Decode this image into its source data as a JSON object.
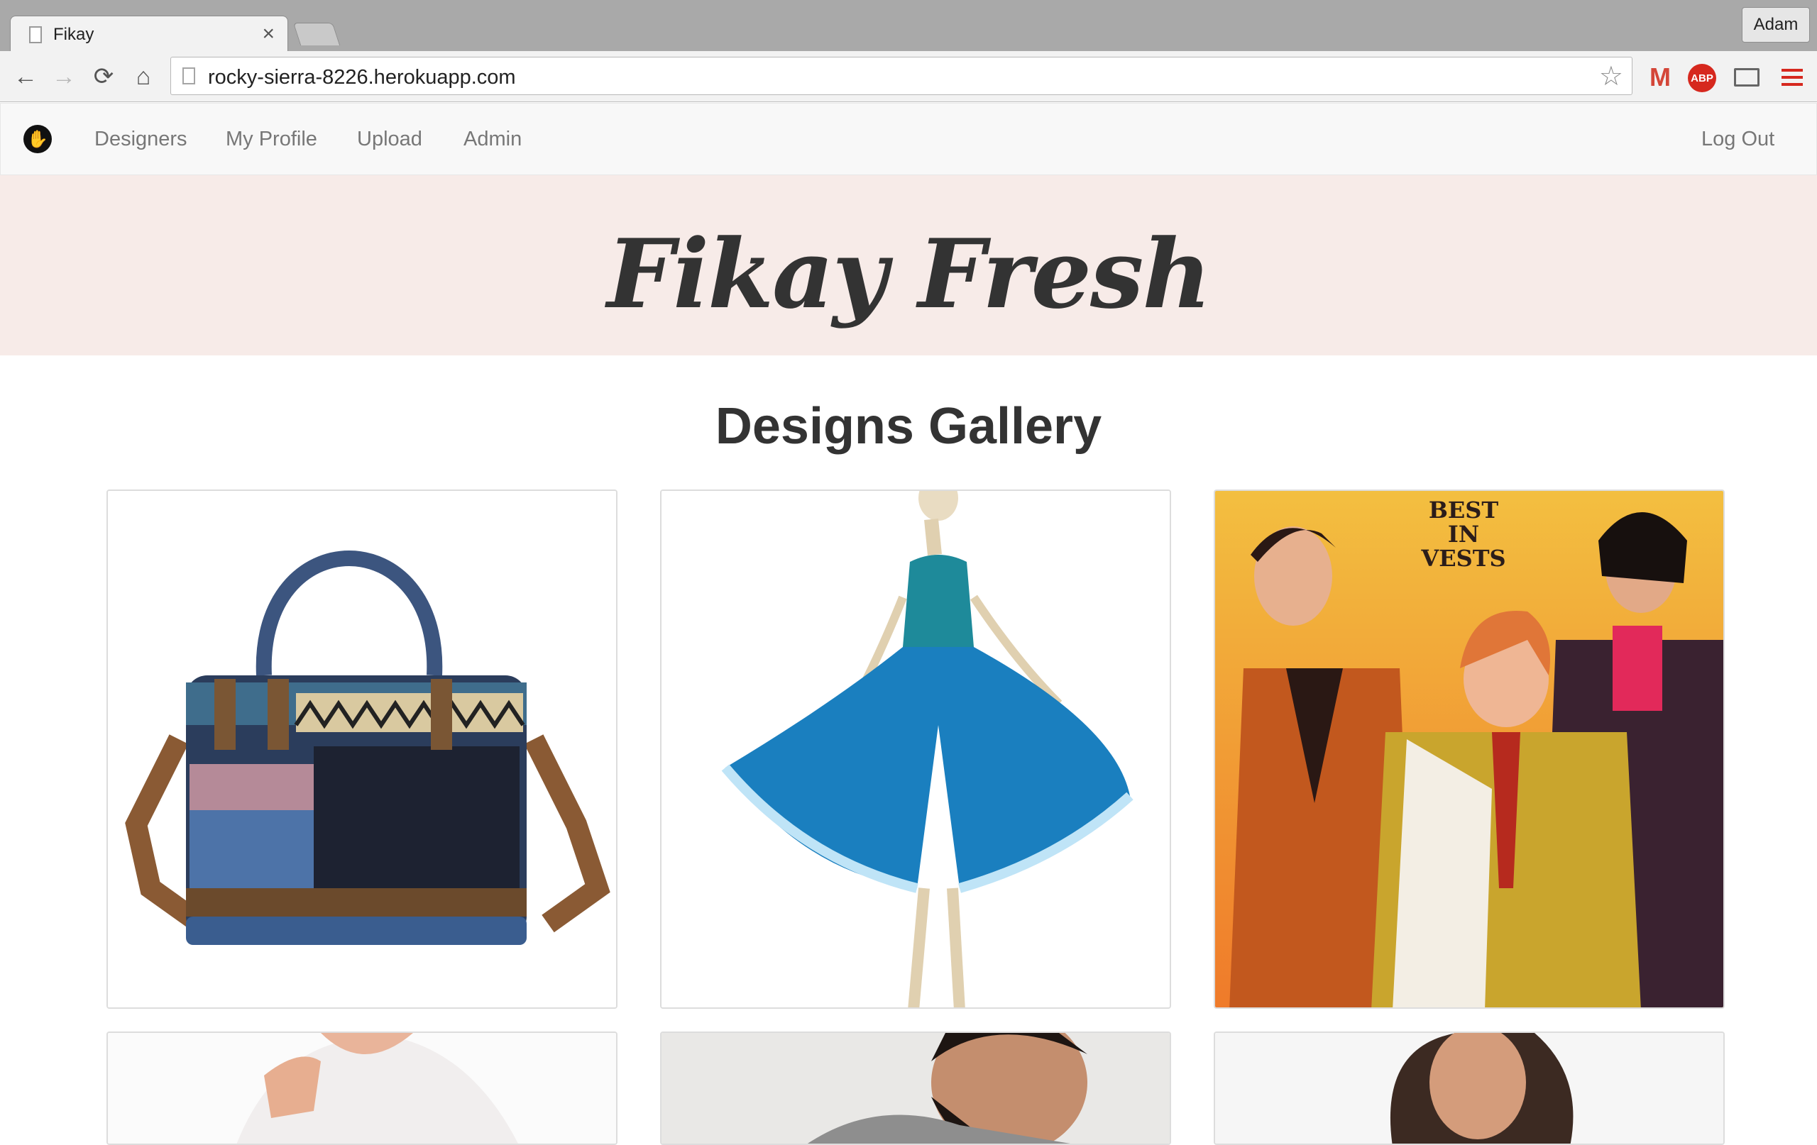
{
  "browser": {
    "tab_title": "Fikay",
    "tab_close": "×",
    "profile_name": "Adam",
    "url": "rocky-sierra-8226.herokuapp.com",
    "back_glyph": "←",
    "forward_glyph": "→",
    "reload_glyph": "⟳",
    "home_glyph": "⌂",
    "star_glyph": "☆",
    "gmail_glyph": "M",
    "abp_label": "ABP",
    "icons": [
      "page-icon",
      "back-icon",
      "forward-icon",
      "reload-icon",
      "home-icon",
      "bookmark-star-icon",
      "gmail-icon",
      "adblock-icon",
      "cast-icon",
      "menu-icon"
    ]
  },
  "navbar": {
    "brand_glyph": "✋",
    "links": [
      "Designers",
      "My Profile",
      "Upload",
      "Admin"
    ],
    "logout": "Log Out"
  },
  "hero": {
    "title": "Fikay Fresh",
    "background": "#f7ebe8"
  },
  "gallery": {
    "title": "Designs Gallery",
    "vests_caption": [
      "BEST",
      "IN",
      "VESTS"
    ],
    "cards": [
      "handbag",
      "blue dress sketch",
      "vests ad",
      "white top",
      "bearded man",
      "woman portrait"
    ]
  }
}
